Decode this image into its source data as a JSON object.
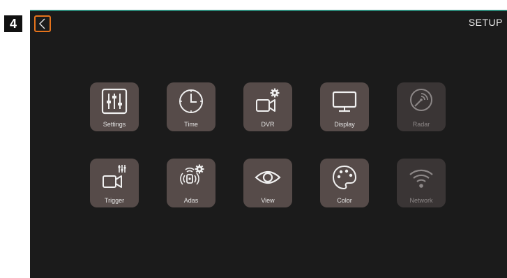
{
  "step_badge": "4",
  "screen": {
    "title": "SETUP",
    "back_icon": "chevron-left-icon"
  },
  "tiles": [
    {
      "label": "Settings",
      "icon": "sliders-icon",
      "enabled": true
    },
    {
      "label": "Time",
      "icon": "clock-icon",
      "enabled": true
    },
    {
      "label": "DVR",
      "icon": "camera-gear-icon",
      "enabled": true
    },
    {
      "label": "Display",
      "icon": "monitor-icon",
      "enabled": true
    },
    {
      "label": "Radar",
      "icon": "radar-icon",
      "enabled": false
    },
    {
      "label": "Trigger",
      "icon": "camera-sliders-icon",
      "enabled": true
    },
    {
      "label": "Adas",
      "icon": "sensor-gear-icon",
      "enabled": true
    },
    {
      "label": "View",
      "icon": "eye-icon",
      "enabled": true
    },
    {
      "label": "Color",
      "icon": "palette-icon",
      "enabled": true
    },
    {
      "label": "Network",
      "icon": "wifi-icon",
      "enabled": false
    }
  ],
  "colors": {
    "accent": "#e5731c",
    "tile": "#564b49",
    "tile_disabled": "#3a3535",
    "screen_bg": "#1b1b1b"
  }
}
